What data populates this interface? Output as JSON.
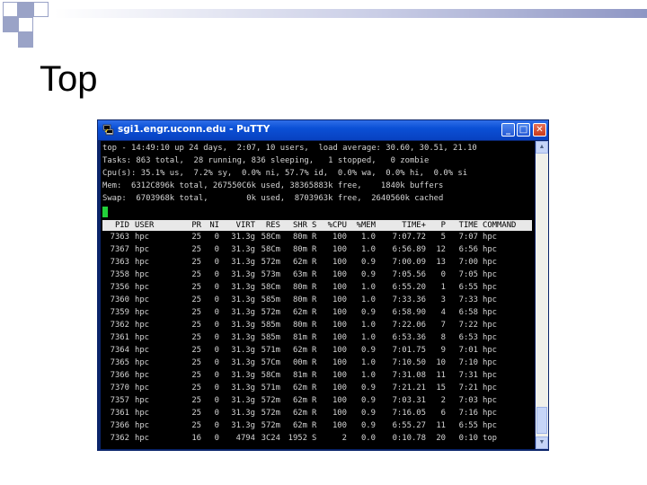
{
  "slide": {
    "title": "Top"
  },
  "window": {
    "title": "sgi1.engr.uconn.edu - PuTTY",
    "minimize_icon": "minimize-icon",
    "maximize_icon": "maximize-icon",
    "close_icon": "close-icon"
  },
  "terminal": {
    "summary": [
      "top - 14:49:10 up 24 days,  2:07, 10 users,  load average: 30.60, 30.51, 21.10",
      "Tasks: 863 total,  28 running, 836 sleeping,   1 stopped,   0 zombie",
      "Cpu(s): 35.1% us,  7.2% sy,  0.0% ni, 57.7% id,  0.0% wa,  0.0% hi,  0.0% si",
      "Mem:  6312C896k total, 267550C6k used, 38365883k free,    1840k buffers",
      "Swap:  6703968k total,        0k used,  8703963k free,  2640560k cached"
    ],
    "headers": [
      "PID",
      "USER",
      "PR",
      "NI",
      "VIRT",
      "RES",
      "SHR",
      "S",
      "%CPU",
      "%MEM",
      "TIME+",
      "P",
      "TIME",
      "COMMAND"
    ],
    "rows": [
      [
        "7363",
        "hpc",
        "25",
        "0",
        "31.3g",
        "58Cm",
        "80m",
        "R",
        "100",
        "1.0",
        "7:07.72",
        "5",
        "7:07",
        "hpc"
      ],
      [
        "7367",
        "hpc",
        "25",
        "0",
        "31.3g",
        "58Cm",
        "80m",
        "R",
        "100",
        "1.0",
        "6:56.89",
        "12",
        "6:56",
        "hpc"
      ],
      [
        "7363",
        "hpc",
        "25",
        "0",
        "31.3g",
        "572m",
        "62m",
        "R",
        "100",
        "0.9",
        "7:00.09",
        "13",
        "7:00",
        "hpc"
      ],
      [
        "7358",
        "hpc",
        "25",
        "0",
        "31.3g",
        "573m",
        "63m",
        "R",
        "100",
        "0.9",
        "7:05.56",
        "0",
        "7:05",
        "hpc"
      ],
      [
        "7356",
        "hpc",
        "25",
        "0",
        "31.3g",
        "58Cm",
        "80m",
        "R",
        "100",
        "1.0",
        "6:55.20",
        "1",
        "6:55",
        "hpc"
      ],
      [
        "7360",
        "hpc",
        "25",
        "0",
        "31.3g",
        "585m",
        "80m",
        "R",
        "100",
        "1.0",
        "7:33.36",
        "3",
        "7:33",
        "hpc"
      ],
      [
        "7359",
        "hpc",
        "25",
        "0",
        "31.3g",
        "572m",
        "62m",
        "R",
        "100",
        "0.9",
        "6:58.90",
        "4",
        "6:58",
        "hpc"
      ],
      [
        "7362",
        "hpc",
        "25",
        "0",
        "31.3g",
        "585m",
        "80m",
        "R",
        "100",
        "1.0",
        "7:22.06",
        "7",
        "7:22",
        "hpc"
      ],
      [
        "7361",
        "hpc",
        "25",
        "0",
        "31.3g",
        "585m",
        "81m",
        "R",
        "100",
        "1.0",
        "6:53.36",
        "8",
        "6:53",
        "hpc"
      ],
      [
        "7364",
        "hpc",
        "25",
        "0",
        "31.3g",
        "571m",
        "62m",
        "R",
        "100",
        "0.9",
        "7:01.75",
        "9",
        "7:01",
        "hpc"
      ],
      [
        "7365",
        "hpc",
        "25",
        "0",
        "31.3g",
        "57Cm",
        "00m",
        "R",
        "100",
        "1.0",
        "7:10.50",
        "10",
        "7:10",
        "hpc"
      ],
      [
        "7366",
        "hpc",
        "25",
        "0",
        "31.3g",
        "58Cm",
        "81m",
        "R",
        "100",
        "1.0",
        "7:31.08",
        "11",
        "7:31",
        "hpc"
      ],
      [
        "7370",
        "hpc",
        "25",
        "0",
        "31.3g",
        "571m",
        "62m",
        "R",
        "100",
        "0.9",
        "7:21.21",
        "15",
        "7:21",
        "hpc"
      ],
      [
        "7357",
        "hpc",
        "25",
        "0",
        "31.3g",
        "572m",
        "62m",
        "R",
        "100",
        "0.9",
        "7:03.31",
        "2",
        "7:03",
        "hpc"
      ],
      [
        "7361",
        "hpc",
        "25",
        "0",
        "31.3g",
        "572m",
        "62m",
        "R",
        "100",
        "0.9",
        "7:16.05",
        "6",
        "7:16",
        "hpc"
      ],
      [
        "7366",
        "hpc",
        "25",
        "0",
        "31.3g",
        "572m",
        "62m",
        "R",
        "100",
        "0.9",
        "6:55.27",
        "11",
        "6:55",
        "hpc"
      ],
      [
        "7362",
        "hpc",
        "16",
        "0",
        "4794",
        "3C24",
        "1952",
        "S",
        "2",
        "0.0",
        "0:10.78",
        "20",
        "0:10",
        "top"
      ]
    ]
  },
  "colors": {
    "terminal_bg": "#000000",
    "terminal_fg": "#d4d4d4",
    "header_bg": "#e8e8e8",
    "cursor": "#22d13a",
    "titlebar": "#0b50d6"
  }
}
